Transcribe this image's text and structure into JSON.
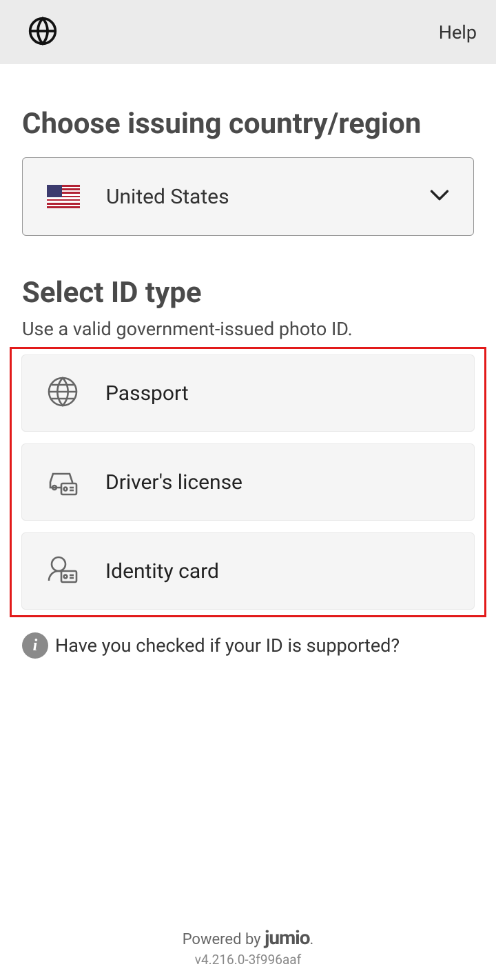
{
  "header": {
    "help_label": "Help"
  },
  "country_section": {
    "title": "Choose issuing country/region",
    "selected": "United States"
  },
  "id_section": {
    "title": "Select ID type",
    "subtitle": "Use a valid government-issued photo ID.",
    "options": [
      {
        "label": "Passport"
      },
      {
        "label": "Driver's license"
      },
      {
        "label": "Identity card"
      }
    ]
  },
  "info": {
    "text": "Have you checked if your ID is supported?"
  },
  "footer": {
    "powered_by_prefix": "Powered by ",
    "brand": "jumio",
    "version": "v4.216.0-3f996aaf"
  }
}
